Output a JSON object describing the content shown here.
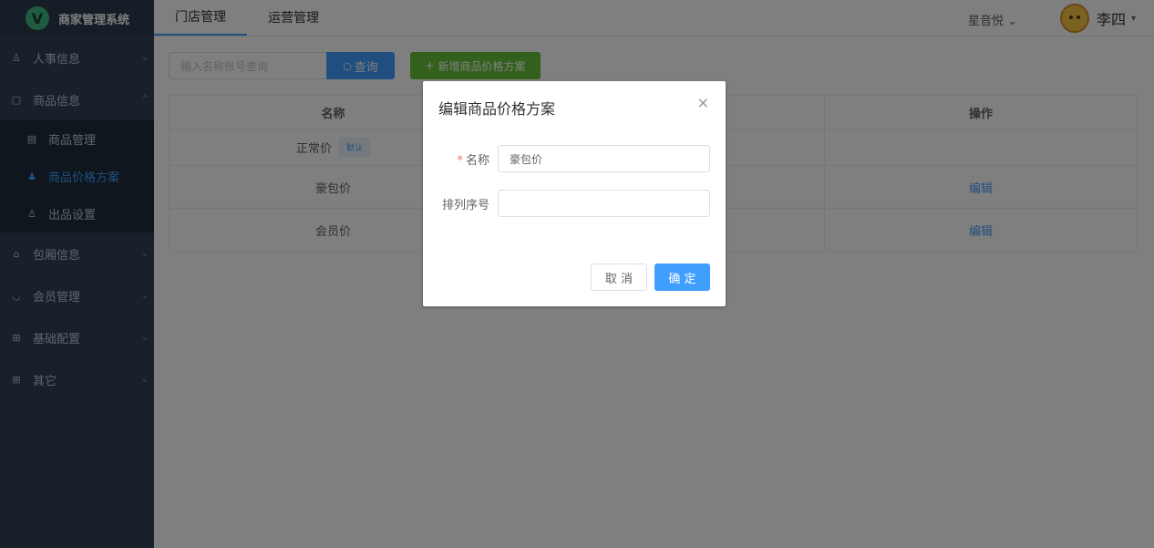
{
  "app": {
    "logo_letter": "V",
    "title": "商家管理系统"
  },
  "sidebar": {
    "items": [
      {
        "label": "人事信息",
        "icon": "person-icon",
        "glyph": "♙",
        "arrow": "⌄"
      },
      {
        "label": "商品信息",
        "icon": "box-icon",
        "glyph": "▢",
        "arrow": "⌃",
        "children": [
          {
            "label": "商品管理",
            "icon": "list-icon",
            "glyph": "▤"
          },
          {
            "label": "商品价格方案",
            "icon": "moneybag-icon",
            "glyph": "♟"
          },
          {
            "label": "出品设置",
            "icon": "user-icon",
            "glyph": "♙"
          }
        ]
      },
      {
        "label": "包厢信息",
        "icon": "home-icon",
        "glyph": "⌂",
        "arrow": "⌄"
      },
      {
        "label": "会员管理",
        "icon": "basket-icon",
        "glyph": "◡",
        "arrow": "⌄"
      },
      {
        "label": "基础配置",
        "icon": "grid-icon",
        "glyph": "⊞",
        "arrow": "⌄"
      },
      {
        "label": "其它",
        "icon": "grid-icon",
        "glyph": "⊞",
        "arrow": "⌄"
      }
    ]
  },
  "topnav": {
    "tabs": [
      {
        "label": "门店管理"
      },
      {
        "label": "运营管理"
      }
    ],
    "store": "星音悦",
    "store_caret": "⌄",
    "user_name": "李四",
    "user_caret": "▾"
  },
  "toolbar": {
    "search_placeholder": "输入名称账号查询",
    "search_button": "查询",
    "search_glyph": "○",
    "add_button": "新增商品价格方案",
    "add_glyph": "+"
  },
  "table": {
    "headers": [
      "名称",
      "",
      "操作"
    ],
    "rows": [
      {
        "name": "正常价",
        "tag": "默认",
        "action": ""
      },
      {
        "name": "豪包价",
        "action": "编辑"
      },
      {
        "name": "会员价",
        "action": "编辑"
      }
    ]
  },
  "dialog": {
    "title": "编辑商品价格方案",
    "close_glyph": "×",
    "required_mark": "*",
    "name_label": "名称",
    "name_value": "豪包价",
    "order_label": "排列序号",
    "order_value": "",
    "cancel": "取 消",
    "ok": "确 定"
  },
  "colors": {
    "primary": "#409eff",
    "success": "#67c23a",
    "sidebar": "#304156"
  }
}
